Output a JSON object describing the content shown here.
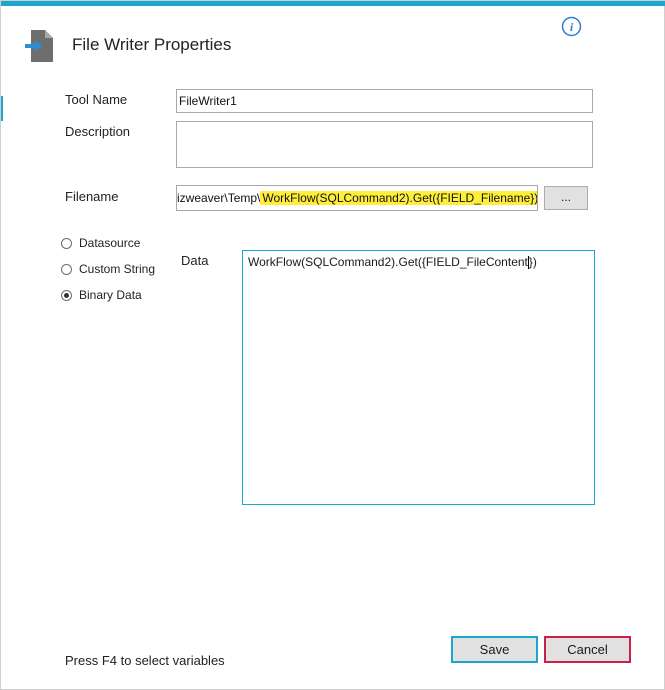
{
  "dialog": {
    "title": "File Writer Properties"
  },
  "form": {
    "tool_name_label": "Tool Name",
    "tool_name_value": "FileWriter1",
    "description_label": "Description",
    "description_value": "",
    "filename_label": "Filename",
    "filename_prefix": "Bizweaver\\Temp\\",
    "filename_expression": "WorkFlow(SQLCommand2).Get({FIELD_Filename})",
    "browse_label": "...",
    "data_label": "Data",
    "data_value_before_caret": "WorkFlow(SQLCommand2).Get({FIELD_FileContent",
    "data_value_after_caret": "})"
  },
  "radio_options": [
    {
      "label": "Datasource",
      "checked": false
    },
    {
      "label": "Custom String",
      "checked": false
    },
    {
      "label": "Binary Data",
      "checked": true
    }
  ],
  "footer": {
    "hint": "Press F4 to select variables",
    "save_label": "Save",
    "cancel_label": "Cancel"
  },
  "colors": {
    "accent": "#1ba6d0",
    "highlight": "#ffef3a",
    "cancel_border": "#c8204a"
  },
  "icons": {
    "header": "file-export-icon",
    "info": "info-icon"
  }
}
